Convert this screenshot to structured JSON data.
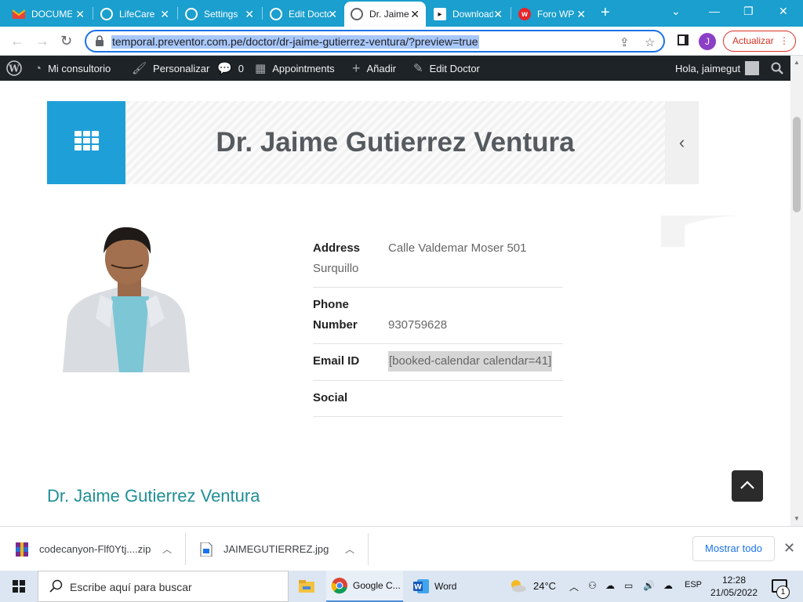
{
  "browser": {
    "tabs": [
      {
        "title": "DOCUMENTACION",
        "icon": "gmail-icon",
        "active": false
      },
      {
        "title": "LifeCare",
        "icon": "globe-icon",
        "active": false
      },
      {
        "title": "Settings",
        "icon": "globe-icon",
        "active": false
      },
      {
        "title": "Edit Doctor",
        "icon": "globe-icon",
        "active": false
      },
      {
        "title": "Dr. Jaime",
        "icon": "globe-icon",
        "active": true
      },
      {
        "title": "Downloads",
        "icon": "download-site-icon",
        "active": false
      },
      {
        "title": "Foro WP",
        "icon": "foro-icon",
        "active": false
      }
    ],
    "url": "temporal.preventor.com.pe/doctor/dr-jaime-gutierrez-ventura/?preview=true",
    "profile_initial": "J",
    "update_label": "Actualizar"
  },
  "adminbar": {
    "items": [
      "Mi consultorio",
      "Personalizar",
      "0",
      "Appointments",
      "Añadir",
      "Edit Doctor"
    ],
    "greeting": "Hola, jaimegut"
  },
  "page": {
    "banner_title": "Dr. Jaime Gutierrez Ventura",
    "address_label": "Address",
    "address_value": "Calle Valdemar Moser 501",
    "address_value_2": "Surquillo",
    "phone_label_1": "Phone",
    "phone_label_2": "Number",
    "phone_value": "930759628",
    "email_label": "Email ID",
    "email_value": "[booked-calendar calendar=41]",
    "social_label": "Social",
    "doctor_name": "Dr. Jaime Gutierrez Ventura"
  },
  "downloads": {
    "items": [
      {
        "name": "codecanyon-Flf0Ytj....zip",
        "icon": "zip-file-icon"
      },
      {
        "name": "JAIMEGUTIERREZ.jpg",
        "icon": "image-file-icon"
      }
    ],
    "show_all": "Mostrar todo"
  },
  "taskbar": {
    "search_placeholder": "Escribe aquí para buscar",
    "apps": [
      {
        "label": "",
        "icon": "file-explorer-icon"
      },
      {
        "label": "Google C...",
        "icon": "chrome-icon"
      },
      {
        "label": "Word",
        "icon": "word-icon"
      }
    ],
    "weather": "24°C",
    "language": "ESP",
    "time": "12:28",
    "date": "21/05/2022",
    "notification_count": "1"
  },
  "colors": {
    "tab_strip": "#1a9fce",
    "banner_blue": "#1f9fd8",
    "admin_bar": "#1d2327",
    "doctor_name": "#1f8f96",
    "update_red": "#d93025"
  }
}
